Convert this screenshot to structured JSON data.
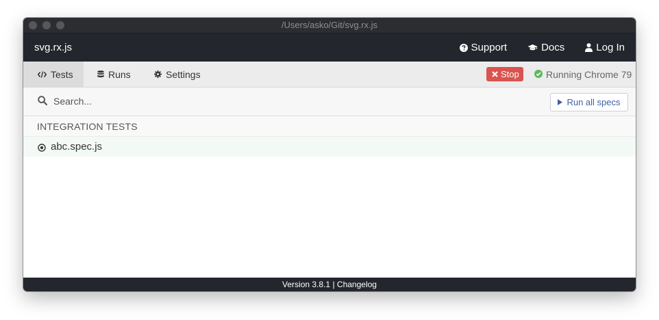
{
  "window": {
    "title": "/Users/asko/Git/svg.rx.js"
  },
  "navbar": {
    "app_name": "svg.rx.js",
    "links": [
      {
        "label": "Support",
        "icon": "question-circle-icon"
      },
      {
        "label": "Docs",
        "icon": "graduation-cap-icon"
      },
      {
        "label": "Log In",
        "icon": "user-icon"
      }
    ]
  },
  "tabs": [
    {
      "label": "Tests",
      "icon": "code-icon",
      "active": true
    },
    {
      "label": "Runs",
      "icon": "database-icon",
      "active": false
    },
    {
      "label": "Settings",
      "icon": "gear-icon",
      "active": false
    }
  ],
  "run_controls": {
    "stop_label": "Stop",
    "browser_status": "Running Chrome 79"
  },
  "search": {
    "placeholder": "Search...",
    "value": "",
    "run_all_label": "Run all specs"
  },
  "specs": {
    "section_title": "INTEGRATION TESTS",
    "files": [
      {
        "name": "abc.spec.js",
        "icon": "dot-circle-icon"
      }
    ]
  },
  "footer": {
    "version": "Version 3.8.1",
    "separator": "|",
    "changelog": "Changelog"
  },
  "colors": {
    "navbar_bg": "#23262d",
    "stop_red": "#d9534f",
    "success_green": "#5cb85c",
    "link_blue": "#3f5fa6"
  }
}
